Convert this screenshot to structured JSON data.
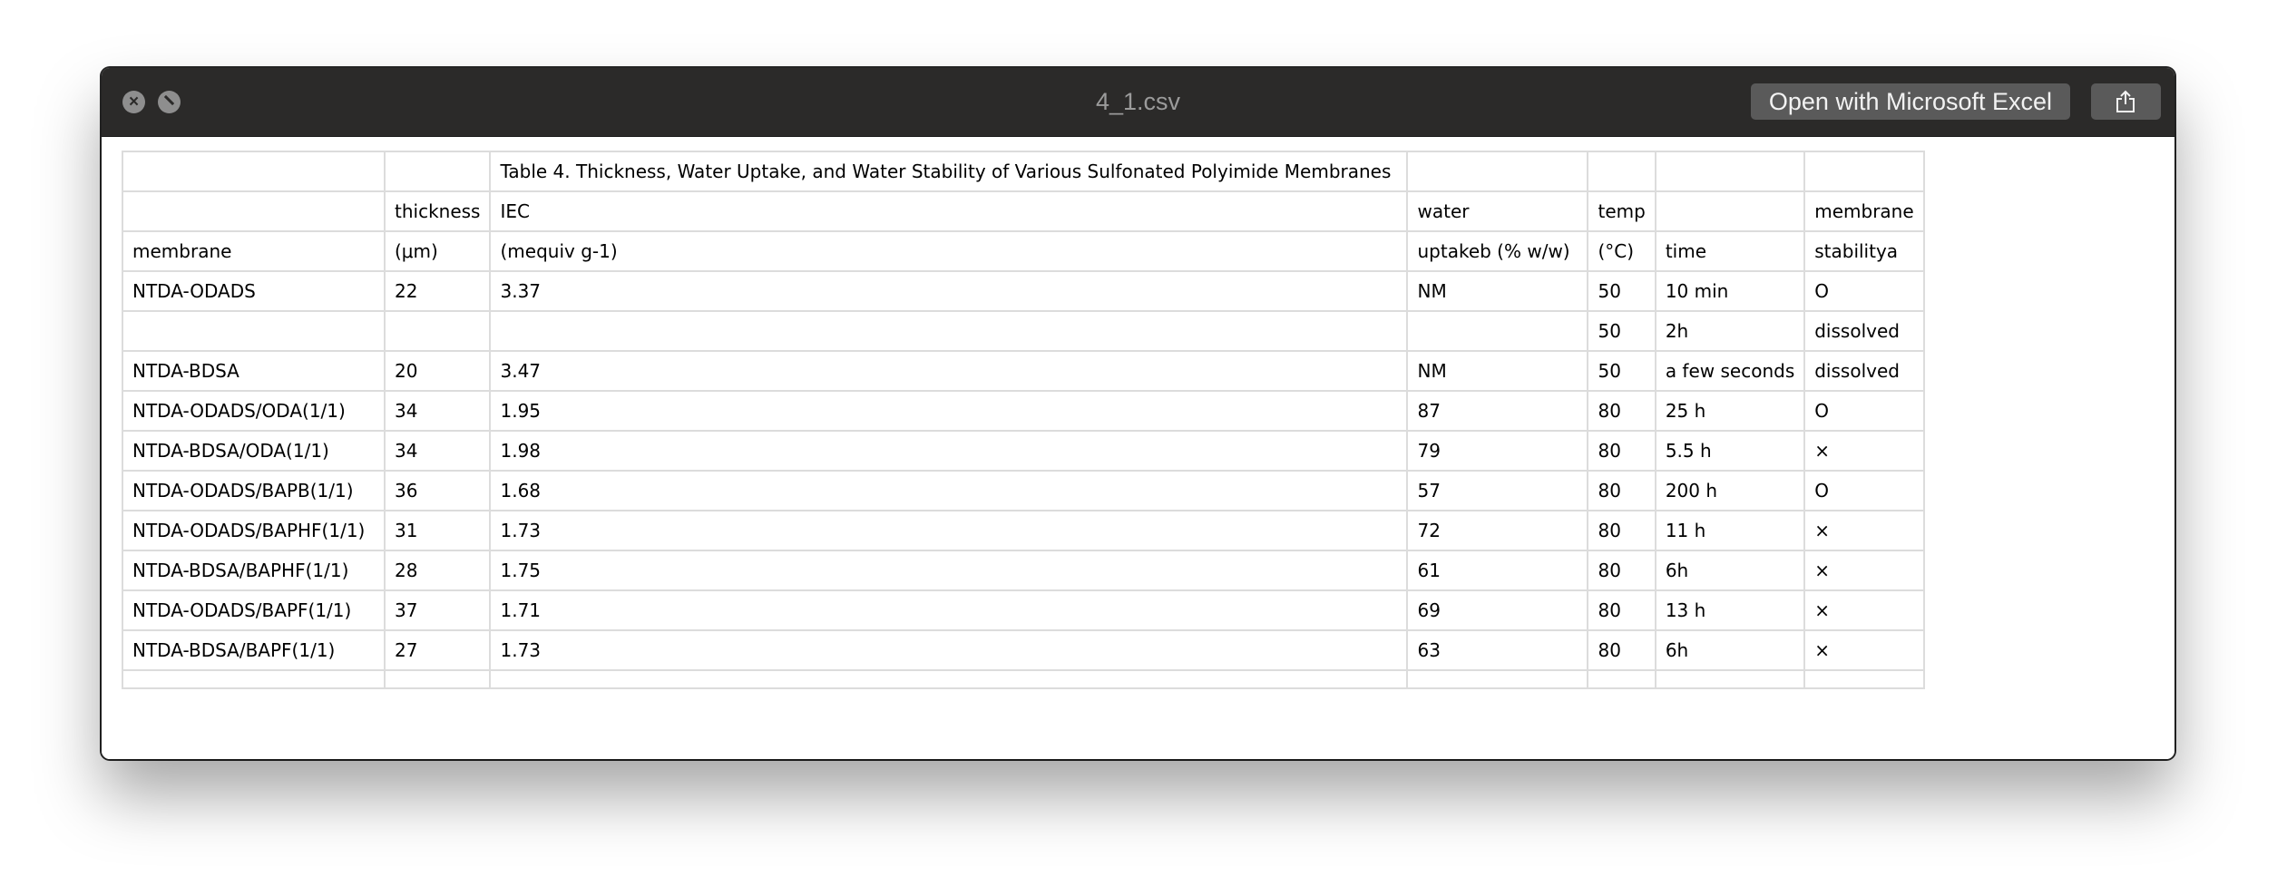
{
  "window": {
    "title": "4_1.csv",
    "open_with_label": "Open with Microsoft Excel"
  },
  "icons": {
    "close": "close-icon",
    "minimize": "minimize-icon",
    "share": "share-icon"
  },
  "colors": {
    "titlebar": "#2b2a29",
    "button": "#5a5a5a",
    "grid": "#dcdcdc"
  },
  "sheet": {
    "rows": [
      [
        "",
        "",
        "Table 4. Thickness, Water Uptake, and Water Stability of Various Sulfonated Polyimide Membranes",
        "",
        "",
        "",
        ""
      ],
      [
        "",
        "thickness",
        "IEC",
        "water",
        "temp",
        "",
        "membrane"
      ],
      [
        "membrane",
        "(μm)",
        "(mequiv g-1)",
        "uptakeb (% w/w)",
        "(°C)",
        "time",
        "stabilitya"
      ],
      [
        "NTDA-ODADS",
        "22",
        "3.37",
        "NM",
        "50",
        "10 min",
        "O"
      ],
      [
        "",
        "",
        "",
        "",
        "50",
        "2h",
        "dissolved"
      ],
      [
        "NTDA-BDSA",
        "20",
        "3.47",
        "NM",
        "50",
        "a few seconds",
        "dissolved"
      ],
      [
        "NTDA-ODADS/ODA(1/1)",
        "34",
        "1.95",
        "87",
        "80",
        "25 h",
        "O"
      ],
      [
        "NTDA-BDSA/ODA(1/1)",
        "34",
        "1.98",
        "79",
        "80",
        "5.5 h",
        "×"
      ],
      [
        "NTDA-ODADS/BAPB(1/1)",
        "36",
        "1.68",
        "57",
        "80",
        "200 h",
        "O"
      ],
      [
        "NTDA-ODADS/BAPHF(1/1)",
        "31",
        "1.73",
        "72",
        "80",
        "11 h",
        "×"
      ],
      [
        "NTDA-BDSA/BAPHF(1/1)",
        "28",
        "1.75",
        "61",
        "80",
        "6h",
        "×"
      ],
      [
        "NTDA-ODADS/BAPF(1/1)",
        "37",
        "1.71",
        "69",
        "80",
        "13 h",
        "×"
      ],
      [
        "NTDA-BDSA/BAPF(1/1)",
        "27",
        "1.73",
        "63",
        "80",
        "6h",
        "×"
      ],
      [
        "",
        "",
        "",
        "",
        "",
        "",
        ""
      ]
    ]
  }
}
